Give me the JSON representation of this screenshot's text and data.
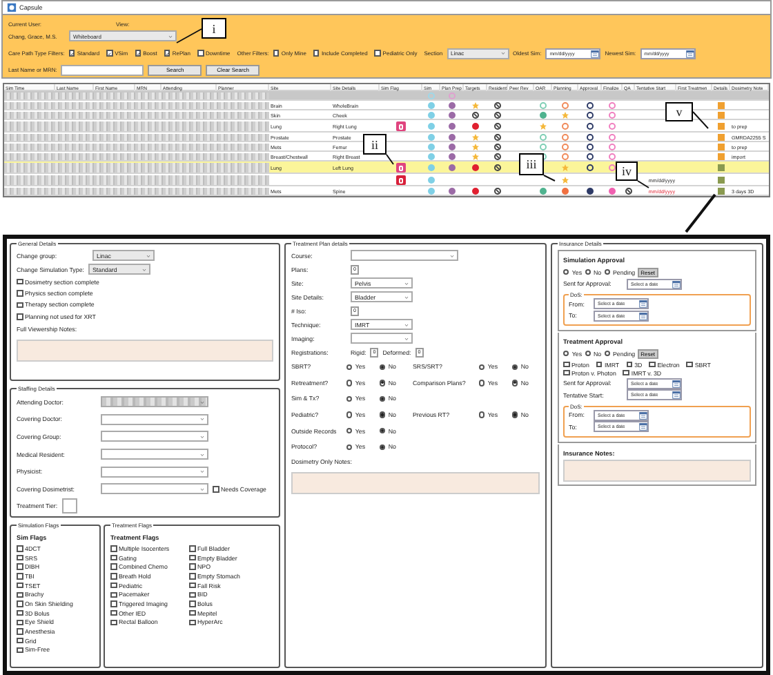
{
  "window": {
    "title": "Capsule"
  },
  "filters": {
    "current_user_label": "Current User:",
    "current_user": "Chang, Grace, M.S.",
    "view_label": "View:",
    "view": "Whiteboard",
    "care_path_label": "Care Path Type Filters:",
    "care_path": [
      {
        "label": "Standard",
        "checked": true
      },
      {
        "label": "VSim",
        "checked": true
      },
      {
        "label": "Boost",
        "checked": true
      },
      {
        "label": "RePlan",
        "checked": true
      },
      {
        "label": "Downtime",
        "checked": false
      }
    ],
    "other_label": "Other Filters:",
    "other": [
      {
        "label": "Only Mine",
        "checked": false
      },
      {
        "label": "Include Completed",
        "checked": false
      },
      {
        "label": "Pediatric Only",
        "checked": false
      }
    ],
    "section_label": "Section",
    "section": "Linac",
    "oldest_label": "Oldest Sim:",
    "oldest_placeholder": "mm/dd/yyyy",
    "newest_label": "Newest Sim:",
    "newest_placeholder": "mm/dd/yyyy",
    "search_label": "Last Name or MRN:",
    "search_button": "Search",
    "clear_button": "Clear Search"
  },
  "table": {
    "columns": [
      "Sim Time",
      "Last Name",
      "First Name",
      "MRN",
      "Attending",
      "Planner",
      "Site",
      "Site Details",
      "Sim Flag",
      "Sim",
      "Plan Prep",
      "Targets",
      "Resident",
      "Peer Rev",
      "OAR",
      "Planning",
      "Approval",
      "Finalize",
      "QA",
      "Tentative Start",
      "First Treatmen",
      "Details",
      "Dosimetry Note"
    ],
    "rows": [
      {
        "kind": "group",
        "selected": false,
        "status": [
          {
            "kind": "ring",
            "color": "#9fd8e8"
          },
          {
            "kind": "ring",
            "color": "#e0a0d0"
          },
          {
            "kind": "blank"
          },
          {
            "kind": "blank"
          },
          {
            "kind": "blank"
          },
          {
            "kind": "blank"
          },
          {
            "kind": "blank"
          },
          {
            "kind": "blank"
          },
          {
            "kind": "blank"
          },
          {
            "kind": "blank"
          }
        ]
      },
      {
        "kind": "patient",
        "selected": false,
        "site": "Brain",
        "site_details": "WholeBrain",
        "details": {
          "color": "#f0a030"
        },
        "status": [
          {
            "kind": "dot",
            "color": "#7fd0e6"
          },
          {
            "kind": "dot",
            "color": "#9b6aa6"
          },
          {
            "kind": "star",
            "color": "#f5b83a"
          },
          {
            "kind": "ban",
            "color": "#444444"
          },
          {
            "kind": "blank"
          },
          {
            "kind": "ring",
            "color": "#7fcfb5"
          },
          {
            "kind": "ring",
            "color": "#f08a5a"
          },
          {
            "kind": "ring",
            "color": "#2d3a66"
          },
          {
            "kind": "ring",
            "color": "#f080c0"
          },
          {
            "kind": "blank"
          }
        ]
      },
      {
        "kind": "patient",
        "selected": false,
        "site": "Skin",
        "site_details": "Cheek",
        "details": {
          "color": "#f0a030"
        },
        "status": [
          {
            "kind": "dot",
            "color": "#7fd0e6"
          },
          {
            "kind": "dot",
            "color": "#9b6aa6"
          },
          {
            "kind": "ban",
            "color": "#444444"
          },
          {
            "kind": "ban",
            "color": "#444444"
          },
          {
            "kind": "blank"
          },
          {
            "kind": "dot",
            "color": "#4fb38f"
          },
          {
            "kind": "star",
            "color": "#f5b83a"
          },
          {
            "kind": "ring",
            "color": "#2d3a66"
          },
          {
            "kind": "ring",
            "color": "#f080c0"
          },
          {
            "kind": "blank"
          }
        ]
      },
      {
        "kind": "patient",
        "selected": false,
        "site": "Lung",
        "site_details": "Right Lung",
        "flag": {
          "color": "#e0447f"
        },
        "details": {
          "color": "#f0a030"
        },
        "note": "to prep",
        "status": [
          {
            "kind": "dot",
            "color": "#7fd0e6"
          },
          {
            "kind": "dot",
            "color": "#9b6aa6"
          },
          {
            "kind": "dot",
            "color": "#e02030"
          },
          {
            "kind": "ban",
            "color": "#444444"
          },
          {
            "kind": "blank"
          },
          {
            "kind": "star",
            "color": "#f5b83a"
          },
          {
            "kind": "ring",
            "color": "#f08a5a"
          },
          {
            "kind": "ring",
            "color": "#2d3a66"
          },
          {
            "kind": "ring",
            "color": "#f080c0"
          },
          {
            "kind": "blank"
          }
        ]
      },
      {
        "kind": "patient",
        "selected": false,
        "site": "Prostate",
        "site_details": "Prostate",
        "details": {
          "color": "#f0a030"
        },
        "note": "GMRDA2255 S",
        "status": [
          {
            "kind": "dot",
            "color": "#7fd0e6"
          },
          {
            "kind": "dot",
            "color": "#9b6aa6"
          },
          {
            "kind": "star",
            "color": "#f5b83a"
          },
          {
            "kind": "ban",
            "color": "#444444"
          },
          {
            "kind": "blank"
          },
          {
            "kind": "ring",
            "color": "#7fcfb5"
          },
          {
            "kind": "ring",
            "color": "#f08a5a"
          },
          {
            "kind": "ring",
            "color": "#2d3a66"
          },
          {
            "kind": "ring",
            "color": "#f080c0"
          },
          {
            "kind": "blank"
          }
        ]
      },
      {
        "kind": "patient",
        "selected": false,
        "site": "Mets",
        "site_details": "Femur",
        "details": {
          "color": "#f0a030"
        },
        "note": "to prep",
        "status": [
          {
            "kind": "dot",
            "color": "#7fd0e6"
          },
          {
            "kind": "dot",
            "color": "#9b6aa6"
          },
          {
            "kind": "star",
            "color": "#f5b83a"
          },
          {
            "kind": "ban",
            "color": "#444444"
          },
          {
            "kind": "blank"
          },
          {
            "kind": "ring",
            "color": "#7fcfb5"
          },
          {
            "kind": "ring",
            "color": "#f08a5a"
          },
          {
            "kind": "ring",
            "color": "#2d3a66"
          },
          {
            "kind": "ring",
            "color": "#f080c0"
          },
          {
            "kind": "blank"
          }
        ]
      },
      {
        "kind": "patient",
        "selected": false,
        "site": "Breast/Chestwall",
        "site_details": "Right Breast",
        "details": {
          "color": "#f0a030"
        },
        "note": "import",
        "status": [
          {
            "kind": "dot",
            "color": "#7fd0e6"
          },
          {
            "kind": "dot",
            "color": "#9b6aa6"
          },
          {
            "kind": "star",
            "color": "#f5b83a"
          },
          {
            "kind": "ban",
            "color": "#444444"
          },
          {
            "kind": "blank"
          },
          {
            "kind": "ring",
            "color": "#7fcfb5"
          },
          {
            "kind": "ring",
            "color": "#f08a5a"
          },
          {
            "kind": "ring",
            "color": "#2d3a66"
          },
          {
            "kind": "ring",
            "color": "#f080c0"
          },
          {
            "kind": "blank"
          }
        ]
      },
      {
        "kind": "patient",
        "selected": true,
        "site": "Lung",
        "site_details": "Left Lung",
        "flag": {
          "color": "#e0447f"
        },
        "details": {
          "color": "#8a9a50"
        },
        "status": [
          {
            "kind": "dot",
            "color": "#7fd0e6"
          },
          {
            "kind": "dot",
            "color": "#9b6aa6"
          },
          {
            "kind": "dot",
            "color": "#e02030"
          },
          {
            "kind": "ban",
            "color": "#444444"
          },
          {
            "kind": "blank"
          },
          {
            "kind": "blank"
          },
          {
            "kind": "star",
            "color": "#f5b83a"
          },
          {
            "kind": "ring",
            "color": "#2d3a66"
          },
          {
            "kind": "ring",
            "color": "#f080c0"
          },
          {
            "kind": "blank"
          }
        ]
      },
      {
        "kind": "patient",
        "selected": false,
        "flag": {
          "color": "#d8203a"
        },
        "details": {
          "color": "#8a9a50"
        },
        "tentative_start": "mm/dd/yyyy",
        "late": false,
        "status": [
          {
            "kind": "dot",
            "color": "#7fd0e6"
          },
          {
            "kind": "blank"
          },
          {
            "kind": "blank"
          },
          {
            "kind": "blank"
          },
          {
            "kind": "blank"
          },
          {
            "kind": "blank"
          },
          {
            "kind": "star",
            "color": "#f5b83a"
          },
          {
            "kind": "blank"
          },
          {
            "kind": "blank"
          },
          {
            "kind": "blank"
          }
        ]
      },
      {
        "kind": "patient",
        "selected": false,
        "site": "Mets",
        "site_details": "Spine",
        "details": {
          "color": "#8a9a50"
        },
        "tentative_start": "mm/dd/yyyy",
        "late": true,
        "note": "3 days 3D",
        "status": [
          {
            "kind": "dot",
            "color": "#7fd0e6"
          },
          {
            "kind": "dot",
            "color": "#9b6aa6"
          },
          {
            "kind": "dot",
            "color": "#e02030"
          },
          {
            "kind": "ban",
            "color": "#444444"
          },
          {
            "kind": "blank"
          },
          {
            "kind": "dot",
            "color": "#4fb38f"
          },
          {
            "kind": "dot",
            "color": "#f07040"
          },
          {
            "kind": "dot",
            "color": "#2d3a66"
          },
          {
            "kind": "dot",
            "color": "#f060b0"
          },
          {
            "kind": "ban",
            "color": "#444444"
          }
        ]
      }
    ]
  },
  "callouts": [
    {
      "label": "i"
    },
    {
      "label": "ii"
    },
    {
      "label": "iii"
    },
    {
      "label": "iv"
    },
    {
      "label": "v"
    }
  ],
  "general": {
    "title": "General Details",
    "change_group_label": "Change group:",
    "change_group": "Linac",
    "sim_type_label": "Change Simulation Type:",
    "sim_type": "Standard",
    "checks": [
      {
        "label": "Dosimetry section complete",
        "checked": false
      },
      {
        "label": "Physics section complete",
        "checked": false
      },
      {
        "label": "Therapy section complete",
        "checked": false
      },
      {
        "label": "Planning not used for XRT",
        "checked": false
      }
    ],
    "notes_label": "Full Viewership Notes:"
  },
  "staffing": {
    "title": "Staffing Details",
    "fields": [
      {
        "label": "Attending Doctor:",
        "redacted": true
      },
      {
        "label": "Covering Doctor:",
        "redacted": false
      },
      {
        "label": "Covering Group:",
        "redacted": false
      },
      {
        "label": "Medical Resident:",
        "redacted": false
      },
      {
        "label": "Physicist:",
        "redacted": false
      },
      {
        "label": "Covering Dosimetrist:",
        "redacted": false
      }
    ],
    "needs_coverage": {
      "label": "Needs Coverage",
      "checked": false
    },
    "tier_label": "Treatment Tier:"
  },
  "sim_flags": {
    "title": "Simulation Flags",
    "heading": "Sim Flags",
    "items": [
      {
        "label": "4DCT",
        "checked": false
      },
      {
        "label": "SRS",
        "checked": false
      },
      {
        "label": "DIBH",
        "checked": false
      },
      {
        "label": "TBI",
        "checked": false
      },
      {
        "label": "TSET",
        "checked": false
      },
      {
        "label": "Brachy",
        "checked": false
      },
      {
        "label": "On Skin Shielding",
        "checked": false
      },
      {
        "label": "3D Bolus",
        "checked": false
      },
      {
        "label": "Eye Shield",
        "checked": false
      },
      {
        "label": "Anesthesia",
        "checked": false
      },
      {
        "label": "Grid",
        "checked": false
      },
      {
        "label": "Sim-Free",
        "checked": false
      }
    ]
  },
  "treatment_flags": {
    "title": "Treatment Flags",
    "heading": "Treatment Flags",
    "items": [
      {
        "label": "Multiple Isocenters",
        "checked": false
      },
      {
        "label": "Gating",
        "checked": false
      },
      {
        "label": "Combined Chemo",
        "checked": false
      },
      {
        "label": "Breath Hold",
        "checked": false
      },
      {
        "label": "Pediatric",
        "checked": false
      },
      {
        "label": "Pacemaker",
        "checked": false
      },
      {
        "label": "Triggered Imaging",
        "checked": false
      },
      {
        "label": "Other IED",
        "checked": false
      },
      {
        "label": "Rectal Balloon",
        "checked": false
      },
      {
        "label": "Full Bladder",
        "checked": false
      },
      {
        "label": "Empty Bladder",
        "checked": false
      },
      {
        "label": "NPO",
        "checked": false
      },
      {
        "label": "Empty Stomach",
        "checked": false
      },
      {
        "label": "Fall Risk",
        "checked": false
      },
      {
        "label": "BID",
        "checked": false
      },
      {
        "label": "Bolus",
        "checked": false
      },
      {
        "label": "Mepitel",
        "checked": false
      },
      {
        "label": "HyperArc",
        "checked": false
      }
    ]
  },
  "plan": {
    "title": "Treatment Plan details",
    "fields": [
      {
        "kind": "select",
        "label": "Course:"
      },
      {
        "kind": "number",
        "label": "Plans:",
        "value": "0"
      },
      {
        "kind": "select",
        "label": "Site:",
        "value": "Pelvis"
      },
      {
        "kind": "select",
        "label": "Site Details:",
        "value": "Bladder"
      },
      {
        "kind": "number",
        "label": "# Iso:",
        "value": "0"
      },
      {
        "kind": "select",
        "label": "Technique:",
        "value": "IMRT"
      },
      {
        "kind": "select",
        "label": "Imaging:"
      }
    ],
    "registrations": {
      "label": "Registrations:",
      "rigid_label": "Rigid:",
      "rigid": "0",
      "deformed_label": "Deformed:",
      "deformed": "0"
    },
    "questions": [
      [
        {
          "label": "SBRT?",
          "options": [
            {
              "label": "Yes",
              "selected": false
            },
            {
              "label": "No",
              "selected": true
            }
          ]
        },
        {
          "label": "SRS/SRT?",
          "options": [
            {
              "label": "Yes",
              "selected": false
            },
            {
              "label": "No",
              "selected": true
            }
          ]
        }
      ],
      [
        {
          "label": "Retreatment?",
          "options": [
            {
              "label": "Yes",
              "selected": false
            },
            {
              "label": "No",
              "selected": true
            }
          ]
        },
        {
          "label": "Comparison Plans?",
          "options": [
            {
              "label": "Yes",
              "selected": false
            },
            {
              "label": "No",
              "selected": true
            }
          ]
        }
      ],
      [
        {
          "label": "Sim & Tx?",
          "options": [
            {
              "label": "Yes",
              "selected": false
            },
            {
              "label": "No",
              "selected": true
            }
          ]
        }
      ],
      [
        {
          "label": "Pediatric?",
          "options": [
            {
              "label": "Yes",
              "selected": false
            },
            {
              "label": "No",
              "selected": true
            }
          ]
        },
        {
          "label": "Previous RT?",
          "options": [
            {
              "label": "Yes",
              "selected": false
            },
            {
              "label": "No",
              "selected": true
            }
          ]
        }
      ],
      [
        {
          "label": "Outside Records",
          "options": [
            {
              "label": "Yes",
              "selected": false
            },
            {
              "label": "No",
              "selected": true
            }
          ]
        }
      ],
      [
        {
          "label": "Protocol?",
          "options": [
            {
              "label": "Yes",
              "selected": false
            },
            {
              "label": "No",
              "selected": true
            }
          ]
        }
      ]
    ],
    "notes_label": "Dosimetry Only Notes:"
  },
  "insurance": {
    "title": "Insurance Details",
    "sim_approval": {
      "heading": "Simulation Approval",
      "options": [
        {
          "label": "Yes",
          "selected": false
        },
        {
          "label": "No",
          "selected": false
        },
        {
          "label": "Pending",
          "selected": false
        }
      ],
      "reset": "Reset",
      "dates": [
        {
          "label": "Sent for Approval:",
          "placeholder": "Select a date"
        }
      ],
      "dos": {
        "title": "DoS:",
        "dates": [
          {
            "label": "From:",
            "placeholder": "Select a date"
          },
          {
            "label": "To:",
            "placeholder": "Select a date"
          }
        ]
      }
    },
    "tx_approval": {
      "heading": "Treatment Approval",
      "options": [
        {
          "label": "Yes",
          "selected": false
        },
        {
          "label": "No",
          "selected": false
        },
        {
          "label": "Pending",
          "selected": false
        }
      ],
      "reset": "Reset",
      "modalities": [
        {
          "label": "Proton",
          "checked": false
        },
        {
          "label": "IMRT",
          "checked": false
        },
        {
          "label": "3D",
          "checked": false
        },
        {
          "label": "Electron",
          "checked": false
        },
        {
          "label": "SBRT",
          "checked": false
        },
        {
          "label": "Proton v. Photon",
          "checked": false
        },
        {
          "label": "IMRT v. 3D",
          "checked": false
        }
      ],
      "dates": [
        {
          "label": "Sent for Approval:",
          "placeholder": "Select a date"
        },
        {
          "label": "Tentative Start:",
          "placeholder": "Select a date"
        }
      ],
      "dos": {
        "title": "DoS:",
        "dates": [
          {
            "label": "From:",
            "placeholder": "Select a date"
          },
          {
            "label": "To:",
            "placeholder": "Select a date"
          }
        ]
      }
    },
    "notes_label": "Insurance Notes:"
  }
}
